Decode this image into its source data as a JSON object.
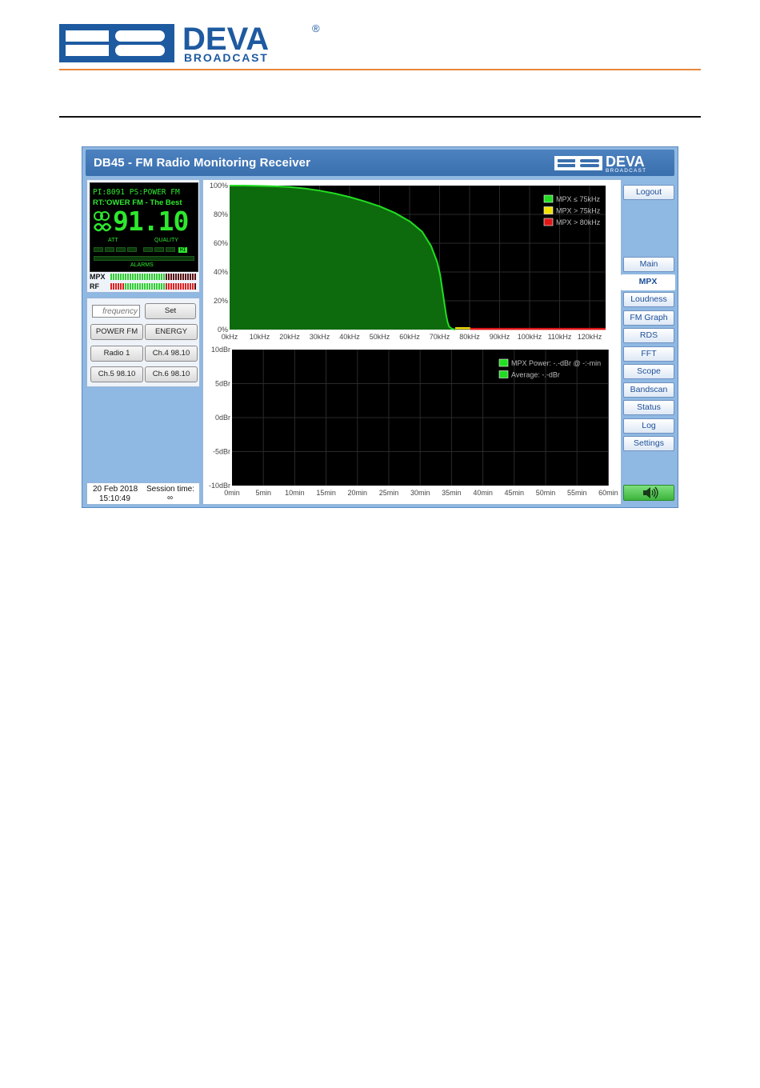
{
  "brand": {
    "name": "DEVA",
    "sub": "BROADCAST",
    "registered": "®"
  },
  "app": {
    "title": "DB45 - FM Radio Monitoring Receiver"
  },
  "lcd": {
    "line1": "PI:8091  PS:POWER  FM",
    "line2": "RT:'OWER FM - The Best",
    "frequency": "91.10",
    "att_label": "ATT",
    "quality_label": "QUALITY",
    "alarms_label": "ALARMS",
    "hi_label": "HI"
  },
  "meters": {
    "mpx_label": "MPX",
    "rf_label": "RF",
    "mpx_level": 0.62,
    "rf_level": 0.95
  },
  "controls": {
    "frequency_placeholder": "frequency",
    "set_label": "Set",
    "presets": [
      "POWER FM",
      "ENERGY",
      "Radio 1",
      "Ch.4 98.10",
      "Ch.5 98.10",
      "Ch.6 98.10"
    ]
  },
  "clock": {
    "date": "20 Feb 2018",
    "time": "15:10:49",
    "session_label": "Session time:",
    "session_value": "∞"
  },
  "nav": {
    "logout": "Logout",
    "items": [
      "Main",
      "MPX",
      "Loudness",
      "FM Graph",
      "RDS",
      "FFT",
      "Scope",
      "Bandscan",
      "Status",
      "Log",
      "Settings"
    ],
    "active": "MPX"
  },
  "colors": {
    "green": "#22dd22",
    "yellow": "#f0e000",
    "red": "#e01818"
  },
  "chart_data": [
    {
      "type": "area",
      "x_labels": [
        "0kHz",
        "10kHz",
        "20kHz",
        "30kHz",
        "40kHz",
        "50kHz",
        "60kHz",
        "70kHz",
        "80kHz",
        "90kHz",
        "100kHz",
        "110kHz",
        "120kHz"
      ],
      "y_labels": [
        "100%",
        "80%",
        "60%",
        "40%",
        "20%",
        "0%"
      ],
      "xlim": [
        0,
        125
      ],
      "ylim": [
        0,
        100
      ],
      "legend_placement": "top-right",
      "series": [
        {
          "name": "MPX ≤ 75kHz",
          "color": "#22dd22",
          "x": [
            0,
            5,
            10,
            15,
            20,
            25,
            30,
            35,
            40,
            45,
            50,
            55,
            60,
            64,
            67,
            69,
            70,
            71,
            72,
            72.5,
            73,
            74,
            75
          ],
          "values": [
            100,
            100,
            99.8,
            99.5,
            99,
            98,
            96.5,
            94.5,
            92,
            89,
            85.5,
            81,
            75,
            68,
            58,
            47,
            38,
            24,
            10,
            5,
            2,
            0.5,
            0
          ]
        },
        {
          "name": "MPX > 75kHz",
          "color": "#f0e000",
          "x": [
            75,
            80
          ],
          "values": [
            1,
            1
          ]
        },
        {
          "name": "MPX > 80kHz",
          "color": "#e01818",
          "x": [
            80,
            125
          ],
          "values": [
            0.5,
            0.5
          ]
        }
      ],
      "grid": true
    },
    {
      "type": "line",
      "x_labels": [
        "0min",
        "5min",
        "10min",
        "15min",
        "20min",
        "25min",
        "30min",
        "35min",
        "40min",
        "45min",
        "50min",
        "55min",
        "60min"
      ],
      "y_labels": [
        "10dBr",
        "5dBr",
        "0dBr",
        "-5dBr",
        "-10dBr"
      ],
      "xlim": [
        0,
        60
      ],
      "ylim": [
        -10,
        10
      ],
      "legend_placement": "top-right",
      "series": [
        {
          "name": "MPX Power: -.-dBr @ -:-min",
          "color": "#22dd22",
          "x": [],
          "values": []
        },
        {
          "name": "Average: -.-dBr",
          "color": "#22dd22",
          "x": [],
          "values": []
        }
      ],
      "grid": true
    }
  ]
}
